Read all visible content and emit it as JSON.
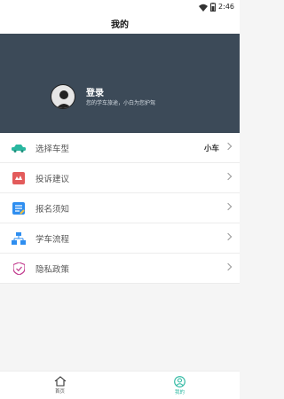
{
  "status_bar": {
    "time": "2:46"
  },
  "header": {
    "title": "我的"
  },
  "profile": {
    "login_title": "登录",
    "subtitle": "您的学车旅途，小白为您护驾"
  },
  "menu": [
    {
      "label": "选择车型",
      "value": "小车",
      "icon": "car-icon"
    },
    {
      "label": "投诉建议",
      "icon": "complaint-icon"
    },
    {
      "label": "报名须知",
      "icon": "notice-icon"
    },
    {
      "label": "学车流程",
      "icon": "process-icon"
    },
    {
      "label": "隐私政策",
      "icon": "shield-icon"
    }
  ],
  "tabs": [
    {
      "label": "首页",
      "icon": "home-icon",
      "active": false
    },
    {
      "label": "我的",
      "icon": "profile-icon",
      "active": true
    }
  ],
  "colors": {
    "banner": "#3c4a58",
    "accent": "#2ab7a0"
  }
}
